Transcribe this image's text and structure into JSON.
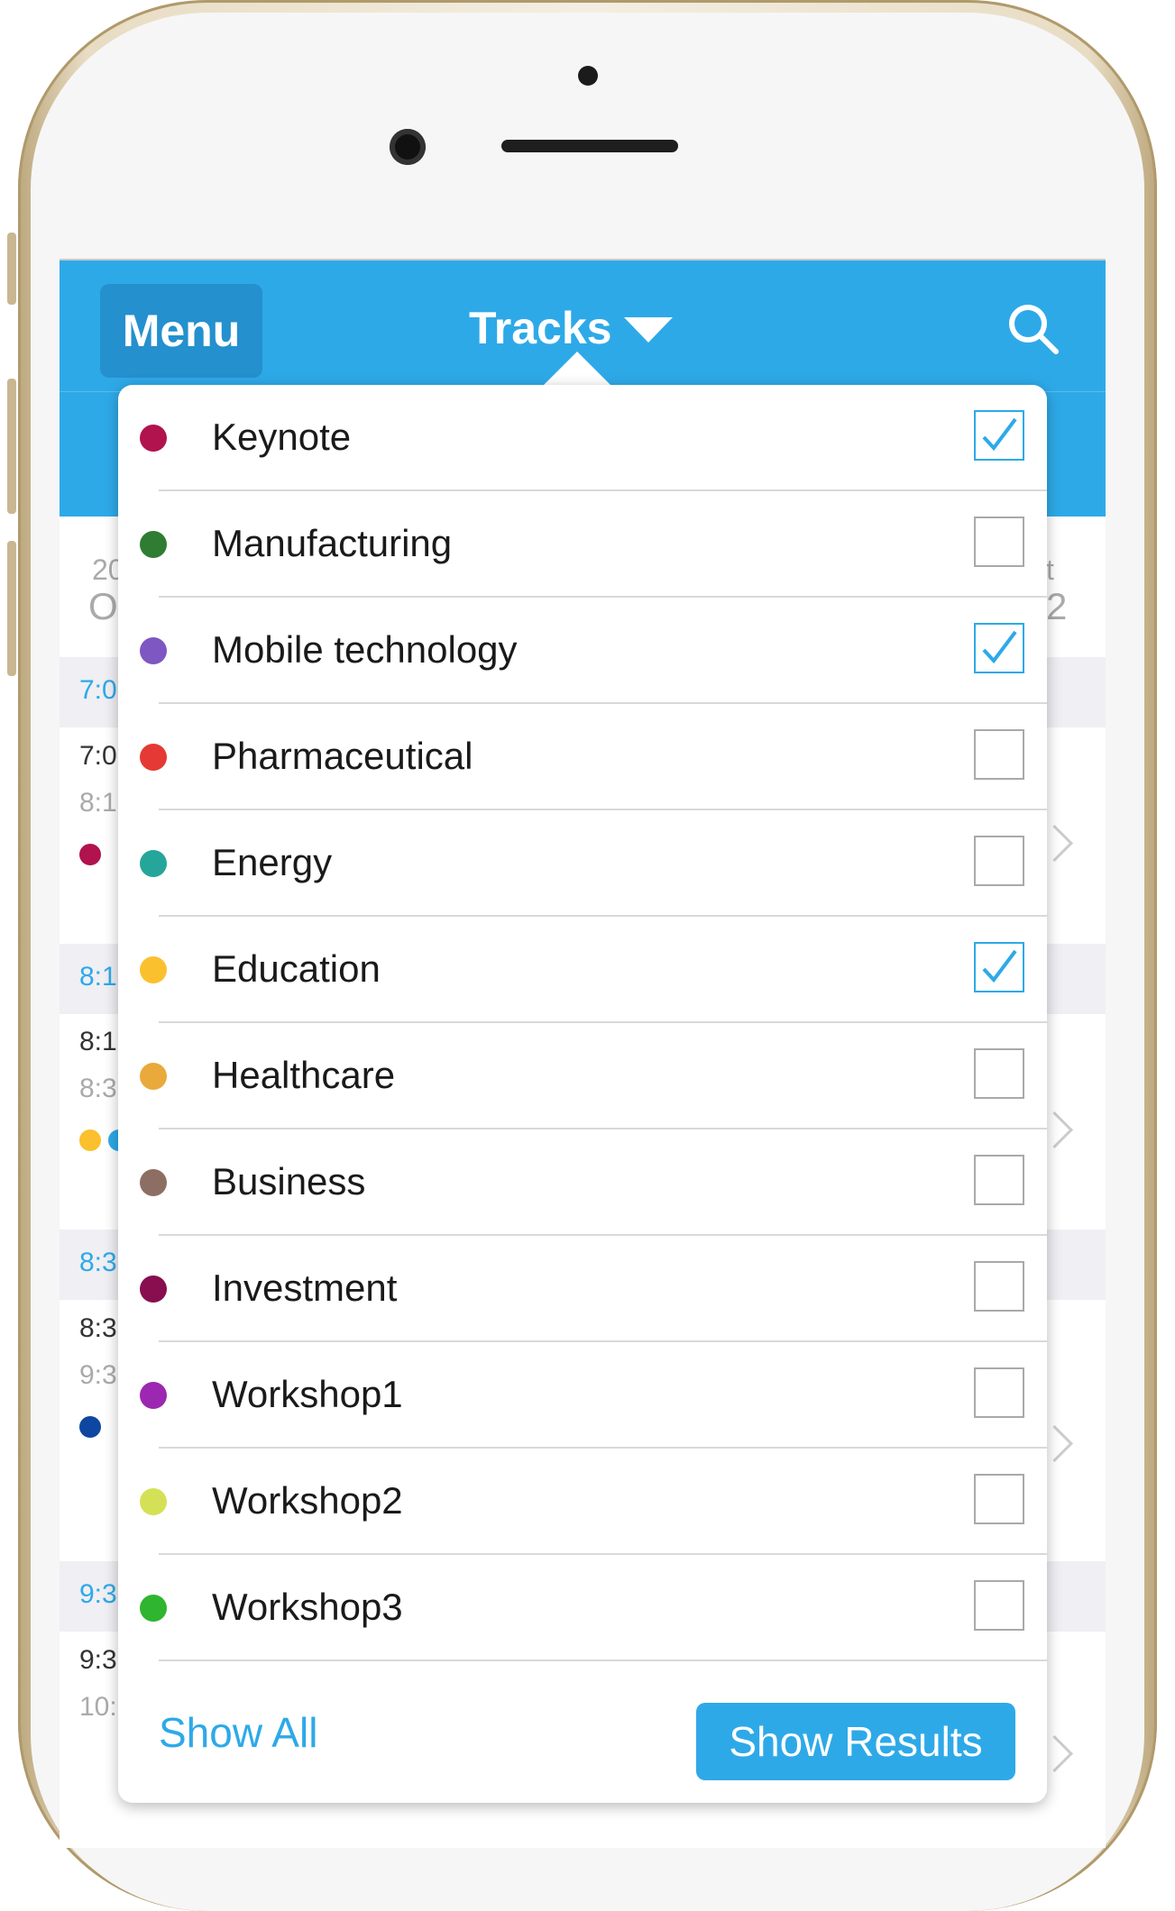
{
  "navbar": {
    "menu_label": "Menu",
    "title": "Tracks",
    "search_icon": "search-icon"
  },
  "background_schedule": {
    "date_top": "20",
    "date_bottom": "O",
    "date_right_top": "t",
    "date_right_bottom": "2",
    "section_times": [
      "7:0",
      "8:1",
      "8:3",
      "9:3"
    ],
    "item_start_times": [
      "7:0",
      "8:1",
      "8:3",
      "9:3"
    ],
    "item_end_times": [
      "8:1",
      "8:3",
      "9:3",
      "10:"
    ]
  },
  "tracks": [
    {
      "label": "Keynote",
      "color": "#b0134e",
      "checked": true
    },
    {
      "label": "Manufacturing",
      "color": "#2e7d32",
      "checked": false
    },
    {
      "label": "Mobile technology",
      "color": "#7e57c2",
      "checked": true
    },
    {
      "label": "Pharmaceutical",
      "color": "#e53935",
      "checked": false
    },
    {
      "label": "Energy",
      "color": "#26a69a",
      "checked": false
    },
    {
      "label": "Education",
      "color": "#fbc02d",
      "checked": true
    },
    {
      "label": "Healthcare",
      "color": "#e9a93b",
      "checked": false
    },
    {
      "label": "Business",
      "color": "#8d6e63",
      "checked": false
    },
    {
      "label": "Investment",
      "color": "#880e4f",
      "checked": false
    },
    {
      "label": "Workshop1",
      "color": "#9c27b0",
      "checked": false
    },
    {
      "label": "Workshop2",
      "color": "#d4e157",
      "checked": false
    },
    {
      "label": "Workshop3",
      "color": "#2fb52f",
      "checked": false
    }
  ],
  "footer": {
    "show_all_label": "Show All",
    "show_results_label": "Show Results"
  },
  "colors": {
    "accent": "#2ea9e8",
    "menu_button": "#2490ce"
  }
}
